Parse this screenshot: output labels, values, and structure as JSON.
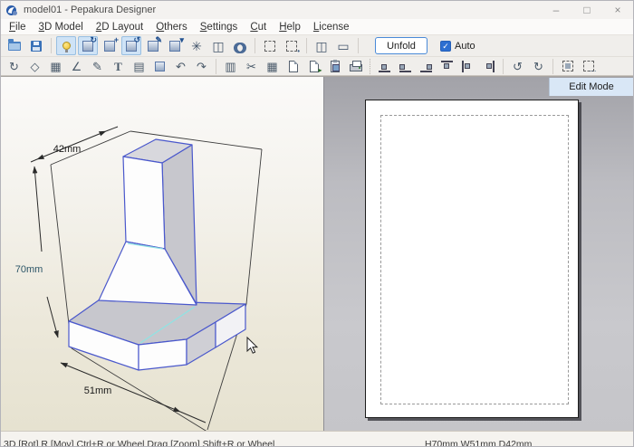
{
  "window": {
    "title": "model01 - Pepakura Designer",
    "minimize_glyph": "–",
    "maximize_glyph": "□",
    "close_glyph": "×"
  },
  "menu": {
    "items": [
      {
        "label": "File"
      },
      {
        "label": "3D Model"
      },
      {
        "label": "2D Layout"
      },
      {
        "label": "Others"
      },
      {
        "label": "Settings"
      },
      {
        "label": "Cut"
      },
      {
        "label": "Help"
      },
      {
        "label": "License"
      }
    ]
  },
  "toolbar_top": {
    "icons": [
      {
        "name": "open-file-icon",
        "active": false
      },
      {
        "name": "save-file-icon",
        "active": false
      },
      {
        "name": "show-light-icon",
        "active": true
      },
      {
        "name": "orbit-camera-icon",
        "active": true
      },
      {
        "name": "move-model-icon",
        "active": false
      },
      {
        "name": "rotate-model-icon",
        "active": true
      },
      {
        "name": "paint-model-icon",
        "active": false
      },
      {
        "name": "fill-color-icon",
        "active": false
      },
      {
        "name": "show-axes-icon",
        "active": false
      },
      {
        "name": "split-view-icon",
        "active": false
      },
      {
        "name": "sync-views-icon",
        "active": false
      },
      {
        "name": "select-region-icon",
        "active": false
      },
      {
        "name": "select-region-options-icon",
        "active": false
      },
      {
        "name": "two-pane-layout-icon",
        "active": false
      },
      {
        "name": "single-pane-layout-icon",
        "active": false
      }
    ],
    "unfold_label": "Unfold",
    "auto_label": "Auto",
    "auto_checked": true,
    "check_glyph": "✓"
  },
  "toolbar_edit": {
    "icons": [
      {
        "name": "update-3d-icon"
      },
      {
        "name": "change-shape-icon"
      },
      {
        "name": "edit-flaps-icon"
      },
      {
        "name": "edit-edge-icon"
      },
      {
        "name": "flip-edge-icon"
      },
      {
        "name": "insert-text-icon"
      },
      {
        "name": "insert-image-icon"
      },
      {
        "name": "texture-settings-icon"
      },
      {
        "name": "undo-icon"
      },
      {
        "name": "redo-icon"
      },
      {
        "name": "check-layout-icon"
      },
      {
        "name": "divide-face-icon"
      },
      {
        "name": "arrange-parts-icon"
      },
      {
        "name": "add-page-icon"
      },
      {
        "name": "move-page-icon"
      },
      {
        "name": "paste-part-icon"
      },
      {
        "name": "print-icon"
      },
      {
        "name": "align-bottom-icon"
      },
      {
        "name": "align-bottom-left-icon"
      },
      {
        "name": "align-bottom-right-icon"
      },
      {
        "name": "align-top-icon"
      },
      {
        "name": "align-left-icon"
      },
      {
        "name": "align-right-icon"
      },
      {
        "name": "rotate-part-ccw-icon"
      },
      {
        "name": "rotate-part-cw-icon"
      },
      {
        "name": "group-select-icon"
      },
      {
        "name": "ungroup-select-icon"
      }
    ]
  },
  "viewport3d": {
    "dim_width": "42mm",
    "dim_height": "70mm",
    "dim_depth": "51mm"
  },
  "pane2d": {
    "edit_mode_label": "Edit Mode"
  },
  "statusbar": {
    "hint": "3D [Rot] R [Mov] Ctrl+R or Wheel Drag [Zoom] Shift+R or Wheel",
    "model_size": "H70mm W51mm D42mm"
  },
  "colors": {
    "accent_blue": "#3a72b8",
    "active_icon_bg": "#cfe3f6",
    "model_edge_blue": "#4a58cc",
    "model_edge_cyan": "#8fe3e3",
    "edit_mode_tab_bg": "#d9e7f6",
    "viewport_bottom": "#e6e2d0"
  }
}
